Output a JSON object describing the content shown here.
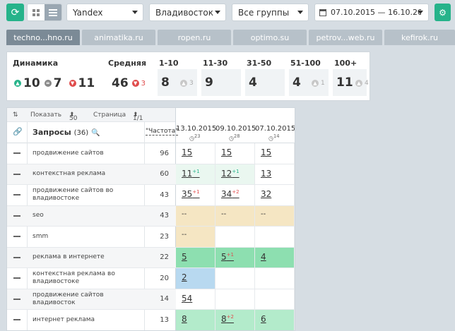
{
  "toolbar": {
    "search_engine": "Yandex",
    "region": "Владивосток [.ru]",
    "groups": "Все группы",
    "date_range": "07.10.2015 — 16.10.2015"
  },
  "site_tabs": [
    "techno...hno.ru",
    "animatika.ru",
    "ropen.ru",
    "optimo.su",
    "petrov...web.ru",
    "kefirok.ru"
  ],
  "stats": {
    "dynamics": {
      "title": "Динамика",
      "up": "10",
      "same": "7",
      "down": "11"
    },
    "average": {
      "title": "Средняя",
      "value": "46",
      "delta": "3"
    },
    "buckets": [
      {
        "title": "1-10",
        "value": "8",
        "delta": "3"
      },
      {
        "title": "11-30",
        "value": "9",
        "delta": ""
      },
      {
        "title": "31-50",
        "value": "4",
        "delta": ""
      },
      {
        "title": "51-100",
        "value": "4",
        "delta": "1"
      },
      {
        "title": "100+",
        "value": "11",
        "delta": "4"
      }
    ]
  },
  "table": {
    "show_label": "Показать",
    "show_value": "50",
    "page_label": "Страница",
    "page_value": "1/1",
    "queries_header": "Запросы",
    "queries_count": "(36)",
    "freq_header": "\"Частота\"",
    "dates": [
      {
        "date": "13.10.2015",
        "count": "23"
      },
      {
        "date": "09.10.2015",
        "count": "28"
      },
      {
        "date": "07.10.2015",
        "count": "14"
      }
    ],
    "rows": [
      {
        "keyword": "продвижение сайтов",
        "freq": "96",
        "pos": [
          {
            "v": "15",
            "s": ""
          },
          {
            "v": "15",
            "s": ""
          },
          {
            "v": "15",
            "s": ""
          }
        ],
        "colors": [
          "#ffffff",
          "#ffffff",
          "#ffffff"
        ]
      },
      {
        "keyword": "контекстная реклама",
        "freq": "60",
        "pos": [
          {
            "v": "11",
            "s": "+1"
          },
          {
            "v": "12",
            "s": "+1"
          },
          {
            "v": "13",
            "s": ""
          }
        ],
        "colors": [
          "#eaf7f0",
          "#eaf7f0",
          "#ffffff"
        ]
      },
      {
        "keyword": "продвижение сайтов во владивостоке",
        "freq": "43",
        "pos": [
          {
            "v": "35",
            "s": "+1"
          },
          {
            "v": "34",
            "s": "+2"
          },
          {
            "v": "32",
            "s": ""
          }
        ],
        "colors": [
          "#ffffff",
          "#ffffff",
          "#ffffff"
        ]
      },
      {
        "keyword": "seo",
        "freq": "43",
        "pos": [
          {
            "v": "--",
            "s": ""
          },
          {
            "v": "--",
            "s": ""
          },
          {
            "v": "--",
            "s": ""
          }
        ],
        "colors": [
          "#f5e6c3",
          "#f5e6c3",
          "#f5e6c3"
        ]
      },
      {
        "keyword": "smm",
        "freq": "23",
        "pos": [
          {
            "v": "--",
            "s": ""
          },
          {
            "v": "",
            "s": ""
          },
          {
            "v": "",
            "s": ""
          }
        ],
        "colors": [
          "#f5e6c3",
          "#ffffff",
          "#ffffff"
        ]
      },
      {
        "keyword": "реклама в интернете",
        "freq": "22",
        "pos": [
          {
            "v": "5",
            "s": ""
          },
          {
            "v": "5",
            "s": "+1"
          },
          {
            "v": "4",
            "s": ""
          }
        ],
        "colors": [
          "#8ddfb0",
          "#8ddfb0",
          "#8ddfb0"
        ]
      },
      {
        "keyword": "контекстная реклама во владивостоке",
        "freq": "20",
        "pos": [
          {
            "v": "2",
            "s": ""
          },
          {
            "v": "",
            "s": ""
          },
          {
            "v": "",
            "s": ""
          }
        ],
        "colors": [
          "#b8d9f0",
          "#ffffff",
          "#ffffff"
        ]
      },
      {
        "keyword": "продвижение сайтов владивосток",
        "freq": "14",
        "pos": [
          {
            "v": "54",
            "s": ""
          },
          {
            "v": "",
            "s": ""
          },
          {
            "v": "",
            "s": ""
          }
        ],
        "colors": [
          "#ffffff",
          "#ffffff",
          "#ffffff"
        ]
      },
      {
        "keyword": "интернет реклама",
        "freq": "13",
        "pos": [
          {
            "v": "8",
            "s": ""
          },
          {
            "v": "8",
            "s": "+2"
          },
          {
            "v": "6",
            "s": ""
          }
        ],
        "colors": [
          "#b3ebcb",
          "#b3ebcb",
          "#b3ebcb"
        ]
      }
    ]
  }
}
